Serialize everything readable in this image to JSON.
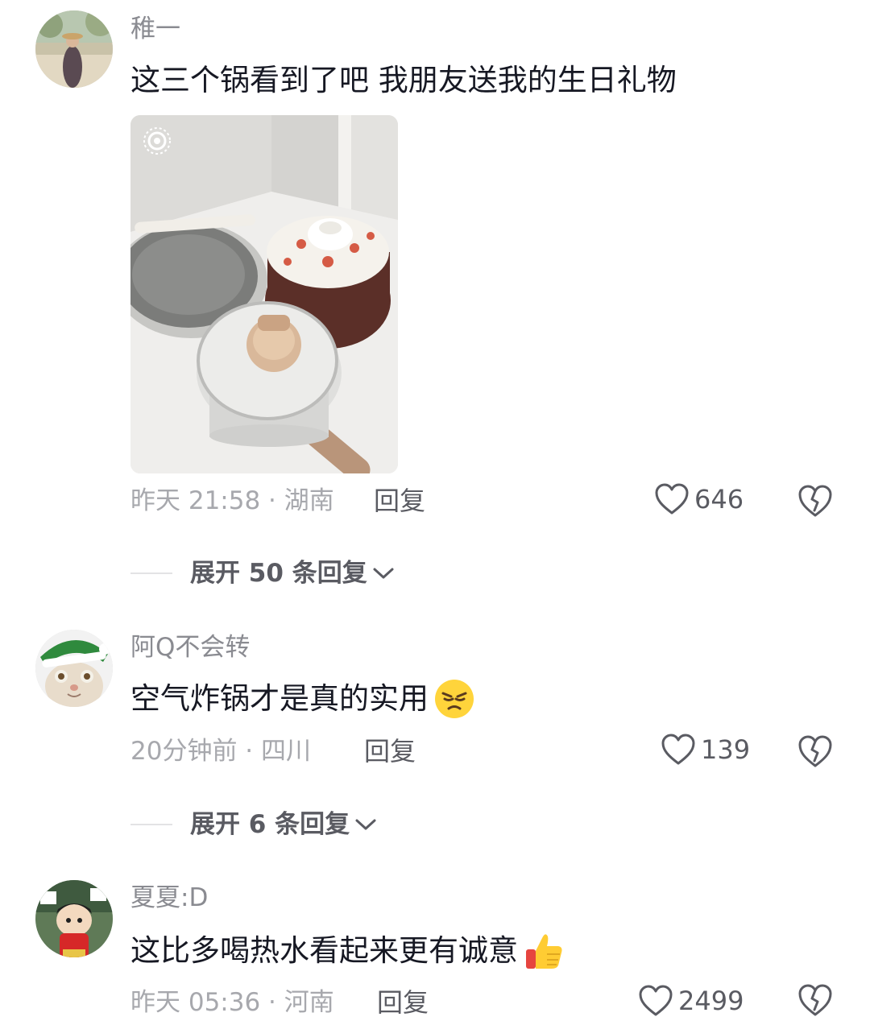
{
  "comments": [
    {
      "username": "稚一",
      "text": "这三个锅看到了吧 我朋友送我的生日礼物",
      "time_location": "昨天 21:58 · 湖南",
      "reply_label": "回复",
      "likes": "646",
      "expand_label": "展开 50 条回复",
      "has_photo": true
    },
    {
      "username": "阿Q不会转",
      "text": "空气炸锅才是真的实用",
      "emoji": "angry-face-emoji",
      "time_location": "20分钟前 · 四川",
      "reply_label": "回复",
      "likes": "139",
      "expand_label": "展开 6 条回复"
    },
    {
      "username": "夏夏:D",
      "text": "这比多喝热水看起来更有诚意",
      "emoji": "thumbs-up-emoji",
      "time_location": "昨天 05:36 · 河南",
      "reply_label": "回复",
      "likes": "2499"
    }
  ],
  "icons": {
    "like": "heart-outline-icon",
    "dislike": "broken-heart-icon",
    "expand": "chevron-down-icon"
  },
  "colors": {
    "text_primary": "#161823",
    "text_secondary": "#8a8b91",
    "meta": "#a7a8ad"
  }
}
